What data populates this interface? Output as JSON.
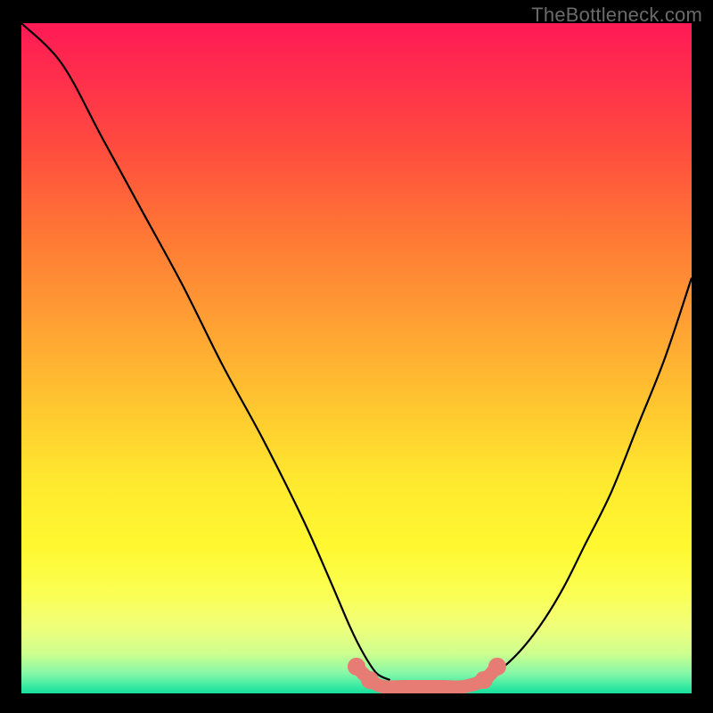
{
  "watermark": "TheBottleneck.com",
  "chart_data": {
    "type": "line",
    "title": "",
    "xlabel": "",
    "ylabel": "",
    "xlim": [
      0,
      100
    ],
    "ylim": [
      0,
      100
    ],
    "series": [
      {
        "name": "left-curve",
        "x": [
          0,
          6,
          12,
          18,
          24,
          30,
          36,
          42,
          46,
          49,
          51,
          53,
          55
        ],
        "y": [
          100,
          94,
          83,
          72,
          61,
          49,
          38,
          26,
          17,
          10,
          6,
          3,
          2
        ]
      },
      {
        "name": "right-curve",
        "x": [
          69,
          72,
          75,
          78,
          81,
          84,
          88,
          92,
          96,
          100
        ],
        "y": [
          2,
          4,
          7,
          11,
          16,
          22,
          30,
          40,
          50,
          62
        ]
      },
      {
        "name": "bottleneck-band",
        "x": [
          50,
          52,
          54,
          57,
          60,
          63,
          66,
          69,
          71
        ],
        "y": [
          4,
          2,
          1,
          1,
          1,
          1,
          1,
          2,
          4
        ]
      }
    ],
    "colors": {
      "curve": "#000000",
      "band": "#e77c74"
    }
  }
}
